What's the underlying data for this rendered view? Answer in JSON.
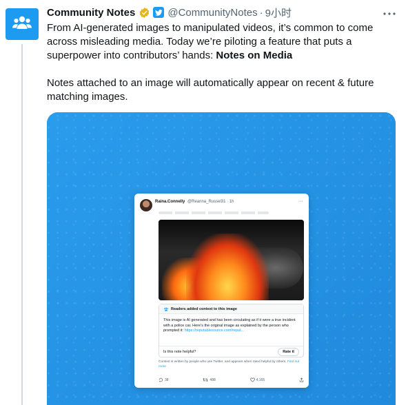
{
  "colors": {
    "accent": "#1d9bf0",
    "media_background": "#2b95e6",
    "text_primary": "#0f1419",
    "text_secondary": "#536471"
  },
  "author": {
    "name": "Community Notes",
    "handle": "@CommunityNotes",
    "separator": "·",
    "time": "9小时",
    "avatar_icon": "people-group-icon",
    "verified_icon": "verified-badge-icon",
    "affiliate_icon": "twitter-bird-badge-icon"
  },
  "tweet": {
    "paragraph1_text": "From AI-generated images to manipulated videos, it’s common to come across misleading media. Today we’re piloting a feature that puts a superpower into contributors’ hands: ",
    "paragraph1_bold": "Notes on Media",
    "paragraph2": "Notes attached to an image will automatically appear on recent & future matching images."
  },
  "embedded_card": {
    "author_name": "Raina.Connelly",
    "author_handle": "@Reanna_Russel31 · 1h",
    "note_title": "Readers added context to this image",
    "note_body": "This image is AI generated and has been circulating as if it were a true incident with a police car. Here’s the original image as explained by the person who prompted it: ",
    "note_link": "https://reputablesource.com/reput...",
    "helpful_question": "Is this note helpful?",
    "rate_button": "Rate it",
    "footer_text": "Context is written by people who use Twitter, and appears when rated helpful by others. ",
    "footer_link": "Find out more",
    "replies": "38",
    "retweets": "488",
    "likes": "4,165"
  }
}
